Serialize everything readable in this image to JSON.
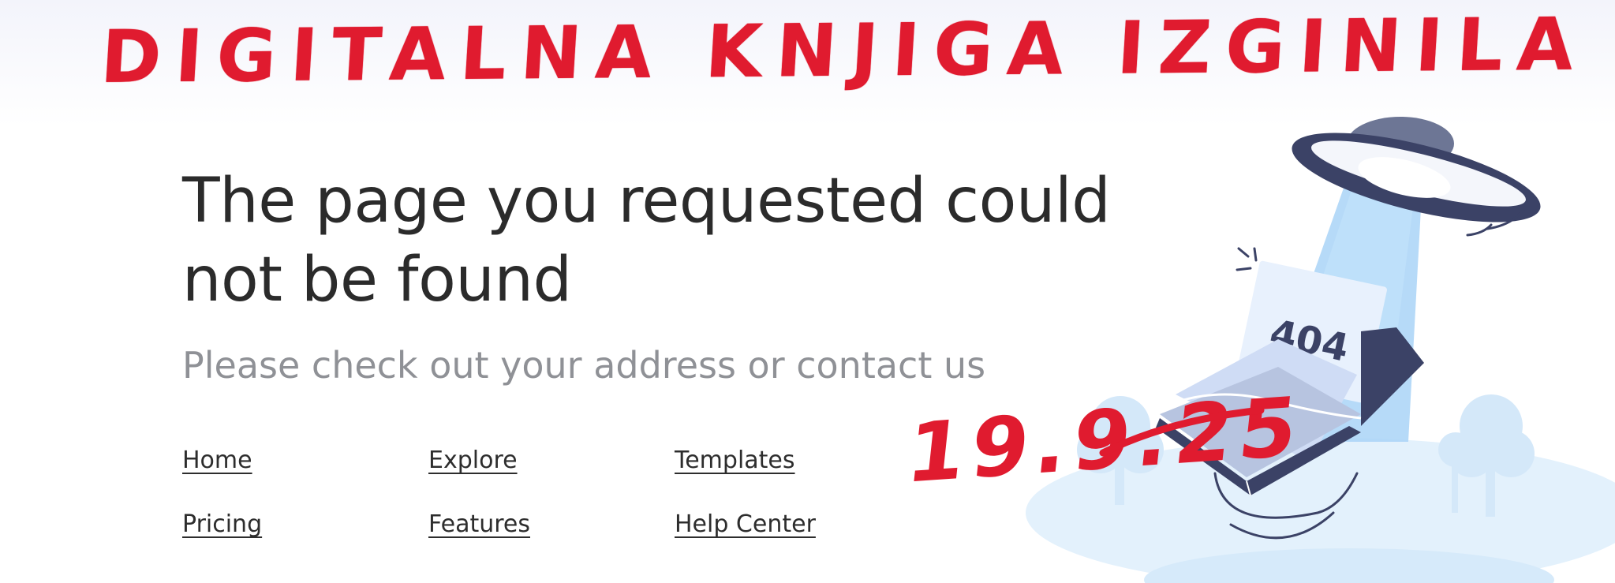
{
  "annotation": {
    "handwritten_title": "DIGITALNA KNJIGA IZGINILA",
    "handwritten_date": "19.9.25",
    "color": "#e01b2f"
  },
  "error": {
    "heading": "The page you requested could not be found",
    "subheading": "Please check out your address or contact us",
    "illustration_label": "404"
  },
  "nav_links": [
    {
      "label": "Home"
    },
    {
      "label": "Explore"
    },
    {
      "label": "Templates"
    },
    {
      "label": "Pricing"
    },
    {
      "label": "Features"
    },
    {
      "label": "Help Center"
    }
  ],
  "colors": {
    "heading": "#2b2b2b",
    "subheading": "#8f9196",
    "ufo": "#3b4266",
    "beam": "#a9d4f7",
    "ground": "#e3f1fc",
    "annotation": "#e01b2f"
  }
}
